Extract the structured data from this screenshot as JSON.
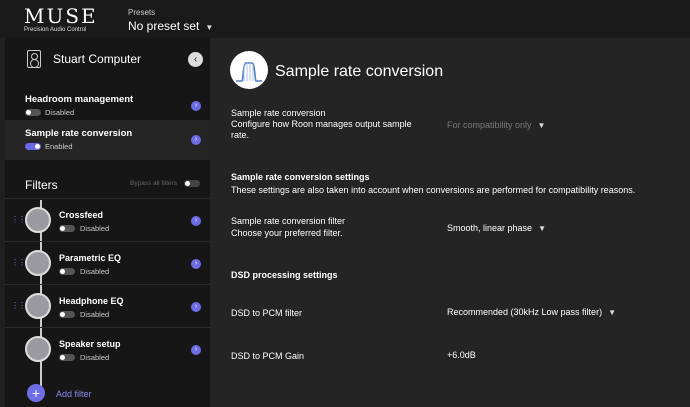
{
  "brand": {
    "name": "MUSE",
    "tagline": "Precision Audio Control"
  },
  "presets": {
    "label": "Presets",
    "value": "No preset set"
  },
  "sidebar": {
    "device": "Stuart Computer",
    "items": [
      {
        "label": "Headroom management",
        "status": "Disabled"
      },
      {
        "label": "Sample rate conversion",
        "status": "Enabled"
      }
    ],
    "filters_title": "Filters",
    "bypass_label": "Bypass all filters",
    "filters": [
      {
        "label": "Crossfeed",
        "status": "Disabled"
      },
      {
        "label": "Parametric EQ",
        "status": "Disabled"
      },
      {
        "label": "Headphone EQ",
        "status": "Disabled"
      },
      {
        "label": "Speaker setup",
        "status": "Disabled"
      }
    ],
    "add_label": "Add filter"
  },
  "main": {
    "title": "Sample rate conversion",
    "src": {
      "label": "Sample rate conversion",
      "desc1": "Configure how Roon manages output sample",
      "desc2": "rate.",
      "value": "For compatibility only"
    },
    "settings_title": "Sample rate conversion settings",
    "settings_desc": "These settings are also taken into account when conversions are performed for compatibility reasons.",
    "filter": {
      "label": "Sample rate conversion filter",
      "desc": "Choose your preferred filter.",
      "value": "Smooth, linear phase"
    },
    "dsd_title": "DSD processing settings",
    "dsd_filter": {
      "label": "DSD to PCM filter",
      "value": "Recommended (30kHz Low pass filter)"
    },
    "dsd_gain": {
      "label": "DSD to PCM Gain",
      "value": "+6.0dB"
    }
  },
  "colors": {
    "accent": "#6d6de6"
  }
}
